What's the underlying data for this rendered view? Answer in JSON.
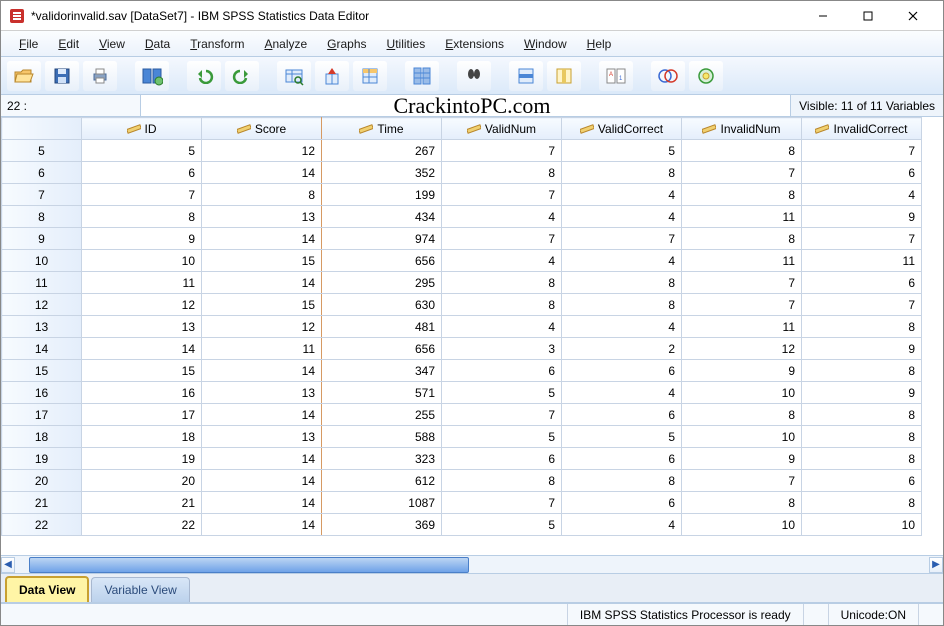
{
  "window": {
    "title": "*validorinvalid.sav [DataSet7] - IBM SPSS Statistics Data Editor"
  },
  "menu": {
    "file": "File",
    "edit": "Edit",
    "view": "View",
    "data": "Data",
    "transform": "Transform",
    "analyze": "Analyze",
    "graphs": "Graphs",
    "utilities": "Utilities",
    "extensions": "Extensions",
    "window": "Window",
    "help": "Help"
  },
  "formulabar": {
    "cellref": "22 :",
    "value": "",
    "visible": "Visible: 11 of 11 Variables"
  },
  "overlay": "CrackintoPC.com",
  "columns": [
    {
      "name": "ID"
    },
    {
      "name": "Score"
    },
    {
      "name": "Time"
    },
    {
      "name": "ValidNum"
    },
    {
      "name": "ValidCorrect"
    },
    {
      "name": "InvalidNum"
    },
    {
      "name": "InvalidCorrect"
    }
  ],
  "rowHeaders": [
    "5",
    "6",
    "7",
    "8",
    "9",
    "10",
    "11",
    "12",
    "13",
    "14",
    "15",
    "16",
    "17",
    "18",
    "19",
    "20",
    "21",
    "22"
  ],
  "rows": [
    [
      "5",
      "12",
      "267",
      "7",
      "5",
      "8",
      "7"
    ],
    [
      "6",
      "14",
      "352",
      "8",
      "8",
      "7",
      "6"
    ],
    [
      "7",
      "8",
      "199",
      "7",
      "4",
      "8",
      "4"
    ],
    [
      "8",
      "13",
      "434",
      "4",
      "4",
      "11",
      "9"
    ],
    [
      "9",
      "14",
      "974",
      "7",
      "7",
      "8",
      "7"
    ],
    [
      "10",
      "15",
      "656",
      "4",
      "4",
      "11",
      "11"
    ],
    [
      "11",
      "14",
      "295",
      "8",
      "8",
      "7",
      "6"
    ],
    [
      "12",
      "15",
      "630",
      "8",
      "8",
      "7",
      "7"
    ],
    [
      "13",
      "12",
      "481",
      "4",
      "4",
      "11",
      "8"
    ],
    [
      "14",
      "11",
      "656",
      "3",
      "2",
      "12",
      "9"
    ],
    [
      "15",
      "14",
      "347",
      "6",
      "6",
      "9",
      "8"
    ],
    [
      "16",
      "13",
      "571",
      "5",
      "4",
      "10",
      "9"
    ],
    [
      "17",
      "14",
      "255",
      "7",
      "6",
      "8",
      "8"
    ],
    [
      "18",
      "13",
      "588",
      "5",
      "5",
      "10",
      "8"
    ],
    [
      "19",
      "14",
      "323",
      "6",
      "6",
      "9",
      "8"
    ],
    [
      "20",
      "14",
      "612",
      "8",
      "8",
      "7",
      "6"
    ],
    [
      "21",
      "14",
      "1087",
      "7",
      "6",
      "8",
      "8"
    ],
    [
      "22",
      "14",
      "369",
      "5",
      "4",
      "10",
      "10"
    ]
  ],
  "tabs": {
    "data": "Data View",
    "variable": "Variable View"
  },
  "status": {
    "processor": "IBM SPSS Statistics Processor is ready",
    "unicode": "Unicode:ON"
  }
}
